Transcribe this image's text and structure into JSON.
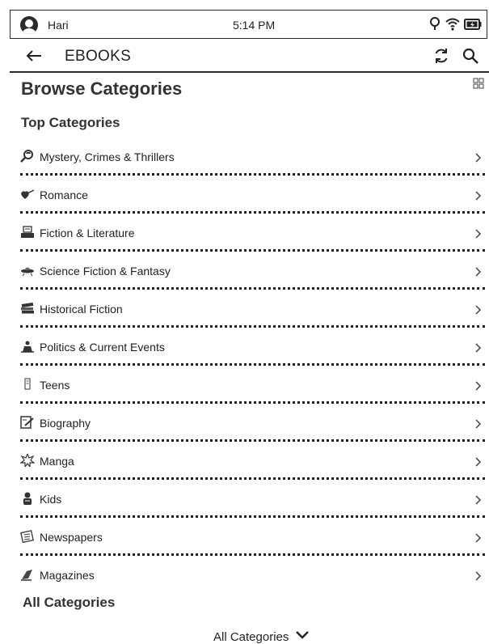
{
  "status_bar": {
    "user": "Hari",
    "time": "5:14 PM",
    "icons": [
      "light-bulb-icon",
      "wifi-icon",
      "battery-charging-icon"
    ]
  },
  "app_bar": {
    "title": "EBOOKS",
    "icons": [
      "back-arrow-icon",
      "sync-icon",
      "search-icon",
      "grid-view-icon"
    ]
  },
  "page": {
    "title": "Browse Categories",
    "top_heading": "Top Categories",
    "all_heading": "All Categories"
  },
  "categories": [
    {
      "label": "Mystery, Crimes & Thrillers",
      "icon": "magnifier-detective-icon"
    },
    {
      "label": "Romance",
      "icon": "heart-arrow-icon"
    },
    {
      "label": "Fiction & Literature",
      "icon": "typewriter-icon"
    },
    {
      "label": "Science Fiction & Fantasy",
      "icon": "ufo-icon"
    },
    {
      "label": "Historical Fiction",
      "icon": "book-stack-icon"
    },
    {
      "label": "Politics & Current Events",
      "icon": "podium-icon"
    },
    {
      "label": "Teens",
      "icon": "scroll-icon"
    },
    {
      "label": "Biography",
      "icon": "pen-paper-icon"
    },
    {
      "label": "Manga",
      "icon": "splash-icon"
    },
    {
      "label": "Kids",
      "icon": "child-icon"
    },
    {
      "label": "Newspapers",
      "icon": "newspaper-icon"
    },
    {
      "label": "Magazines",
      "icon": "magazine-icon"
    }
  ],
  "dropdown": {
    "label": "All Categories"
  }
}
